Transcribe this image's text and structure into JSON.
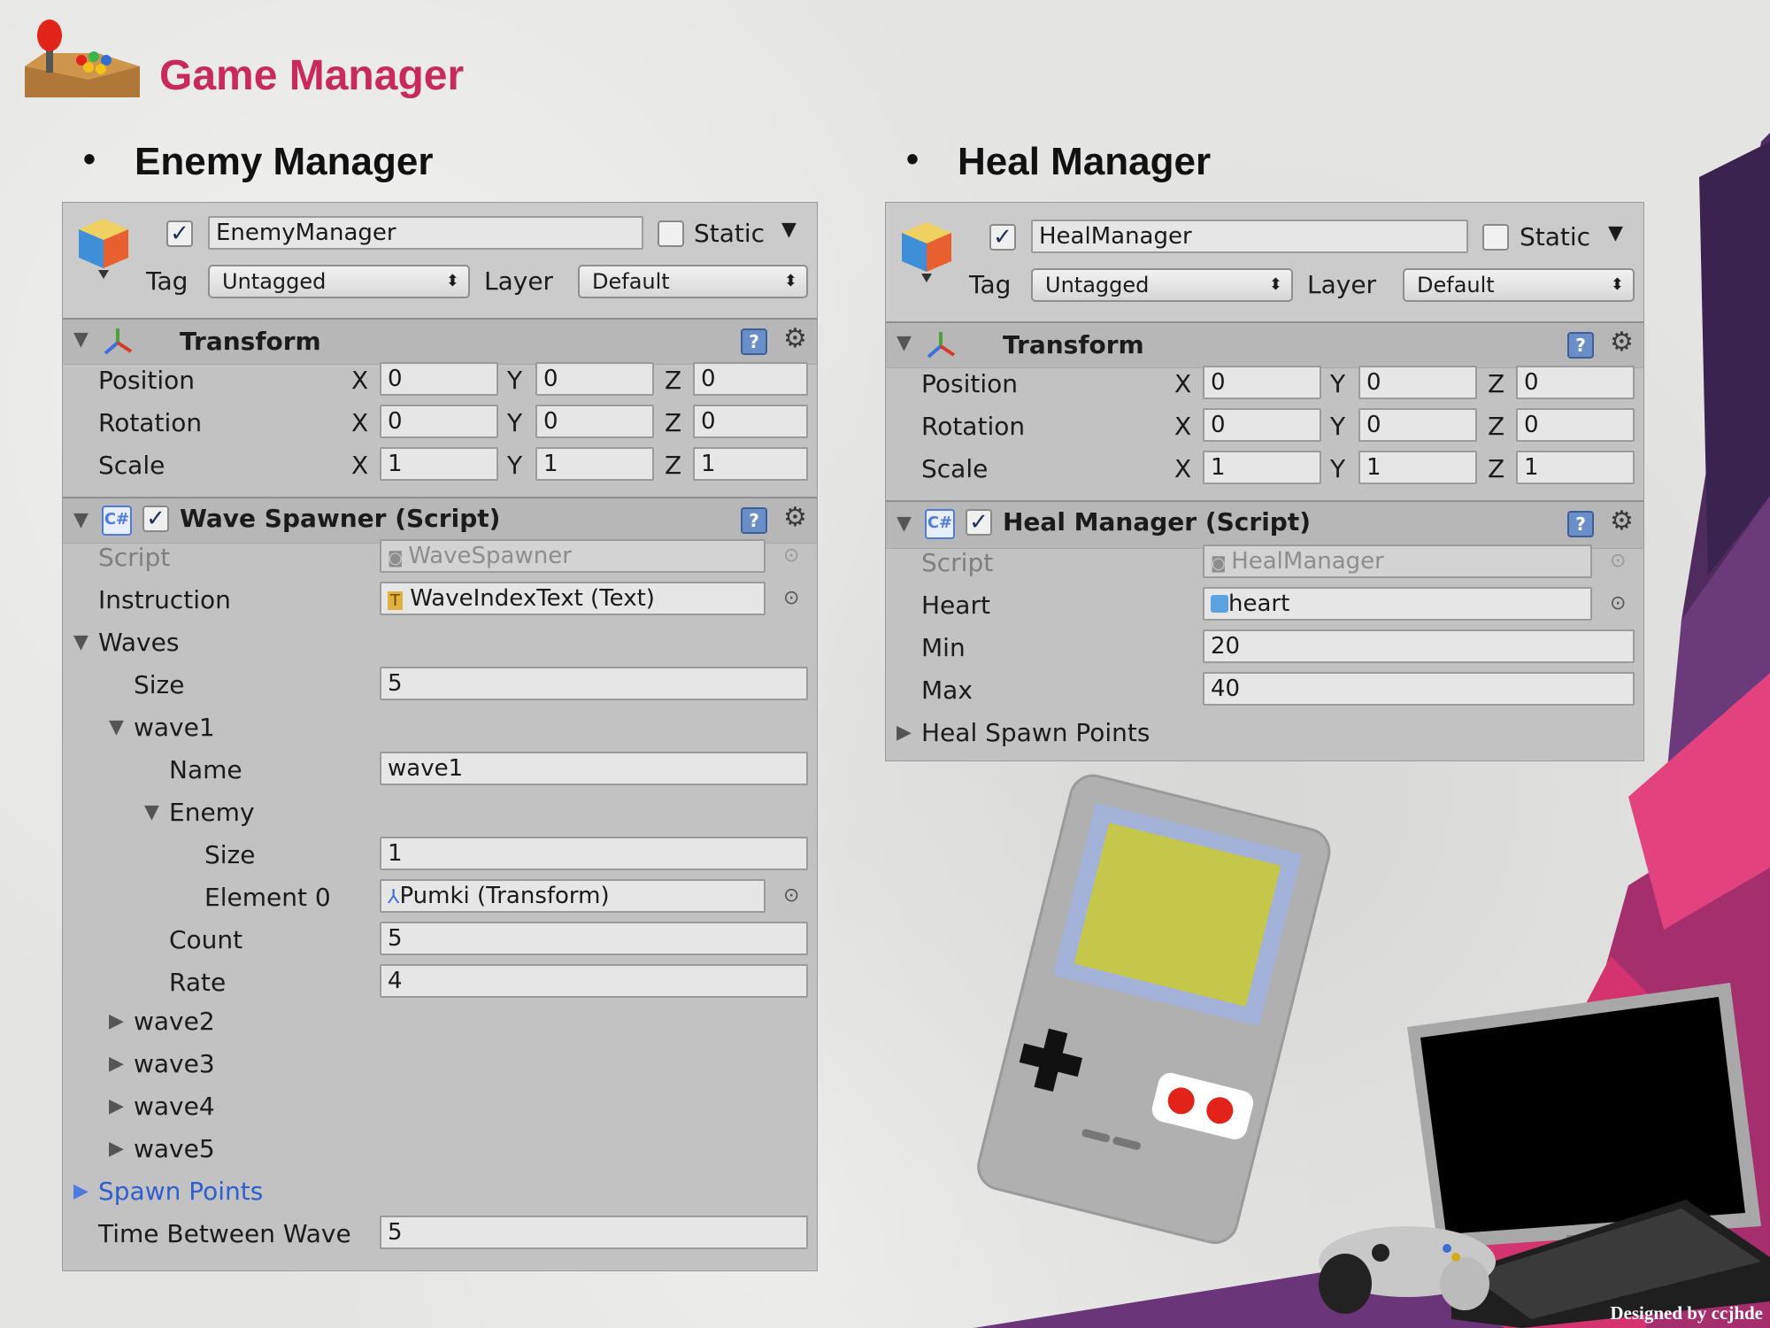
{
  "slide": {
    "title": "Game Manager",
    "footer": "Designed by ccjhde"
  },
  "colors": {
    "title": "#c82a5e",
    "link": "#2d5fcf",
    "panel": "#c2c2c2"
  },
  "enemy": {
    "heading": "Enemy Manager",
    "object_name": "EnemyManager",
    "static_label": "Static",
    "tag_label": "Tag",
    "tag_value": "Untagged",
    "layer_label": "Layer",
    "layer_value": "Default",
    "transform": {
      "title": "Transform",
      "rows": [
        {
          "label": "Position",
          "x": "0",
          "y": "0",
          "z": "0"
        },
        {
          "label": "Rotation",
          "x": "0",
          "y": "0",
          "z": "0"
        },
        {
          "label": "Scale",
          "x": "1",
          "y": "1",
          "z": "1"
        }
      ],
      "axis_x": "X",
      "axis_y": "Y",
      "axis_z": "Z"
    },
    "script": {
      "title": "Wave Spawner (Script)",
      "script_label": "Script",
      "script_value": "WaveSpawner",
      "instruction_label": "Instruction",
      "instruction_value": "WaveIndexText (Text)",
      "waves_label": "Waves",
      "size_label": "Size",
      "size_value": "5",
      "wave1": {
        "label": "wave1",
        "name_label": "Name",
        "name_value": "wave1",
        "enemy_label": "Enemy",
        "enemy_size_label": "Size",
        "enemy_size_value": "1",
        "element_label": "Element 0",
        "element_value": "Pumki (Transform)",
        "count_label": "Count",
        "count_value": "5",
        "rate_label": "Rate",
        "rate_value": "4"
      },
      "collapsed_waves": [
        "wave2",
        "wave3",
        "wave4",
        "wave5"
      ],
      "spawn_points_label": "Spawn Points",
      "time_label": "Time Between Wave",
      "time_value": "5"
    }
  },
  "heal": {
    "heading": "Heal Manager",
    "object_name": "HealManager",
    "static_label": "Static",
    "tag_label": "Tag",
    "tag_value": "Untagged",
    "layer_label": "Layer",
    "layer_value": "Default",
    "transform": {
      "title": "Transform",
      "rows": [
        {
          "label": "Position",
          "x": "0",
          "y": "0",
          "z": "0"
        },
        {
          "label": "Rotation",
          "x": "0",
          "y": "0",
          "z": "0"
        },
        {
          "label": "Scale",
          "x": "1",
          "y": "1",
          "z": "1"
        }
      ],
      "axis_x": "X",
      "axis_y": "Y",
      "axis_z": "Z"
    },
    "script": {
      "title": "Heal Manager (Script)",
      "script_label": "Script",
      "script_value": "HealManager",
      "heart_label": "Heart",
      "heart_value": "heart",
      "min_label": "Min",
      "min_value": "20",
      "max_label": "Max",
      "max_value": "40",
      "spawn_points_label": "Heal Spawn Points"
    }
  }
}
